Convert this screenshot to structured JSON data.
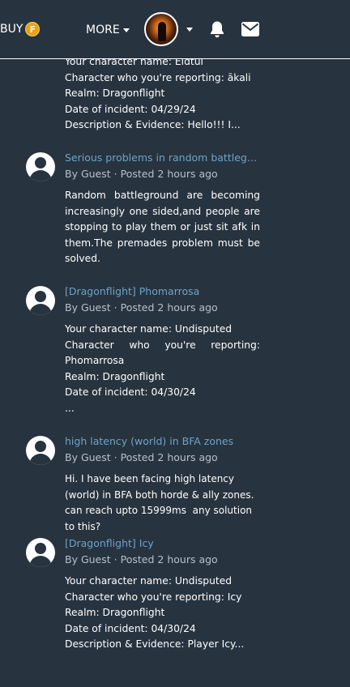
{
  "topbar": {
    "buy_label": "BUY",
    "coin_letter": "F",
    "more_label": "MORE",
    "icons": [
      "user-avatar",
      "chevron-down-icon",
      "bell-icon",
      "mail-icon"
    ]
  },
  "first_post_tail": {
    "lines": [
      "Your character name: Eldtûl",
      "Character who you're reporting: ākali",
      "Realm: Dragonflight",
      "Date of incident: 04/29/24",
      "Description & Evidence: Hello!!! I..."
    ]
  },
  "posts": [
    {
      "title": "Serious problems in random battleground",
      "author": "By Guest",
      "separator": "·",
      "time": "Posted 2 hours ago",
      "excerpt": "Random battleground are becoming increasingly one sided,and people are stopping to play them or just sit afk in them.The premades problem must be solved."
    },
    {
      "title": "[Dragonflight] Phomarrosa",
      "author": "By Guest",
      "separator": "·",
      "time": "Posted 2 hours ago",
      "excerpt_lines": [
        "Your character name: Undisputed",
        "Character who you're reporting: Phomarrosa",
        "Realm: Dragonflight",
        "Date of incident: 04/30/24",
        "..."
      ]
    },
    {
      "title": "high latency (world) in BFA zones",
      "author": "By Guest",
      "separator": "·",
      "time": "Posted 2 hours ago",
      "excerpt": "Hi. I have been facing high latency (world) in BFA both horde & ally zones. can reach upto 15999ms  any solution to this?"
    },
    {
      "title": "[Dragonflight] Icy",
      "author": "By Guest",
      "separator": "·",
      "time": "Posted 2 hours ago",
      "excerpt_lines": [
        "Your character name: Undisputed",
        "Character who you're reporting: Icy",
        "Realm: Dragonflight",
        "Date of incident: 04/30/24",
        "Description & Evidence: Player Icy..."
      ]
    }
  ],
  "colors": {
    "background": "#27333f",
    "link": "#6fa3c8",
    "meta": "#b9c1c9",
    "coin": "#e6a21b"
  }
}
